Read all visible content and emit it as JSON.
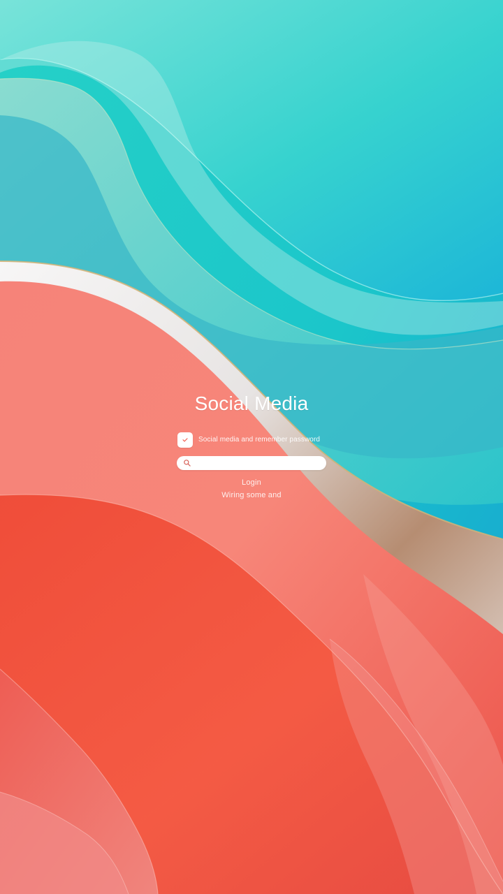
{
  "app": {
    "title": "Social Media"
  },
  "remember": {
    "text": "Social media and remember password"
  },
  "search": {
    "placeholder": "",
    "value": ""
  },
  "links": {
    "login": "Login",
    "signup": "Wiring some and"
  },
  "colors": {
    "teal": "#13c2c6",
    "teal_dark": "#1aa9d2",
    "coral": "#f7674f",
    "coral_dark": "#ed4630",
    "sand": "#d8c2b6"
  },
  "icons": {
    "checkbox": "heart-check-icon",
    "search": "search-icon"
  }
}
